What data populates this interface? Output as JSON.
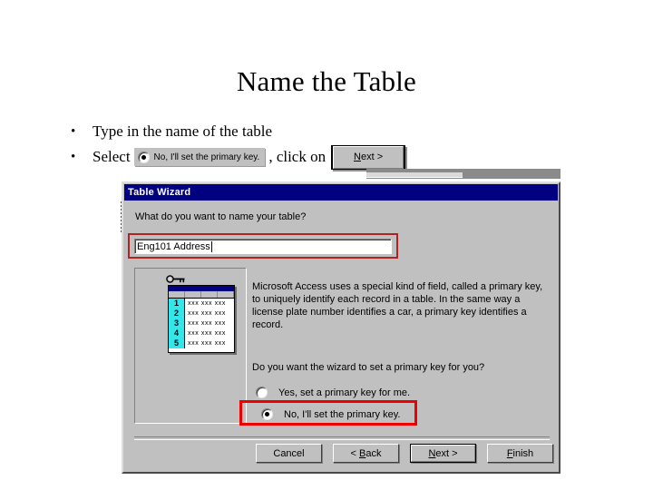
{
  "slide": {
    "title": "Name the Table",
    "bullets": [
      {
        "marker": "•",
        "text_before": "Type in the name of the table",
        "text_after": "",
        "has_radio_chip": false,
        "has_button_chip": false
      },
      {
        "marker": "•",
        "text_before": "Select",
        "radio_chip_label": "No, I'll set the primary key.",
        "text_middle": ", click on",
        "button_chip_label": "Next >",
        "button_chip_mnemonic": "N",
        "has_radio_chip": true,
        "has_button_chip": true
      }
    ]
  },
  "dialog": {
    "title": "Table Wizard",
    "name_prompt": "What do you want to name your table?",
    "name_input_value": "Eng101 Address",
    "name_input_placeholder": "",
    "info_paragraph": "Microsoft Access uses a special kind of field, called a primary key, to uniquely identify each record in a table. In the same way a license plate number identifies a car, a primary key identifies a record.",
    "pk_question": "Do you want the wizard to set a primary key for you?",
    "radio_options": [
      {
        "label": "Yes, set a primary key for me.",
        "selected": false
      },
      {
        "label": "No, I'll set the primary key.",
        "selected": true
      }
    ],
    "buttons": [
      {
        "label": "Cancel",
        "mnemonic": "",
        "default": false
      },
      {
        "label": "< Back",
        "mnemonic": "B",
        "default": false
      },
      {
        "label": "Next >",
        "mnemonic": "N",
        "default": true
      },
      {
        "label": "Finish",
        "mnemonic": "F",
        "default": false
      }
    ],
    "preview": {
      "icon": "key-icon",
      "row_numbers": [
        "1",
        "2",
        "3",
        "4",
        "5"
      ],
      "cell_text": "xxx xxx xxx"
    }
  },
  "colors": {
    "title_bar": "#000080",
    "dialog_face": "#c0c0c0",
    "highlight_red_thin": "#b22222",
    "highlight_red_thick": "#ee0000",
    "row_number_cyan": "#33e6ec"
  }
}
